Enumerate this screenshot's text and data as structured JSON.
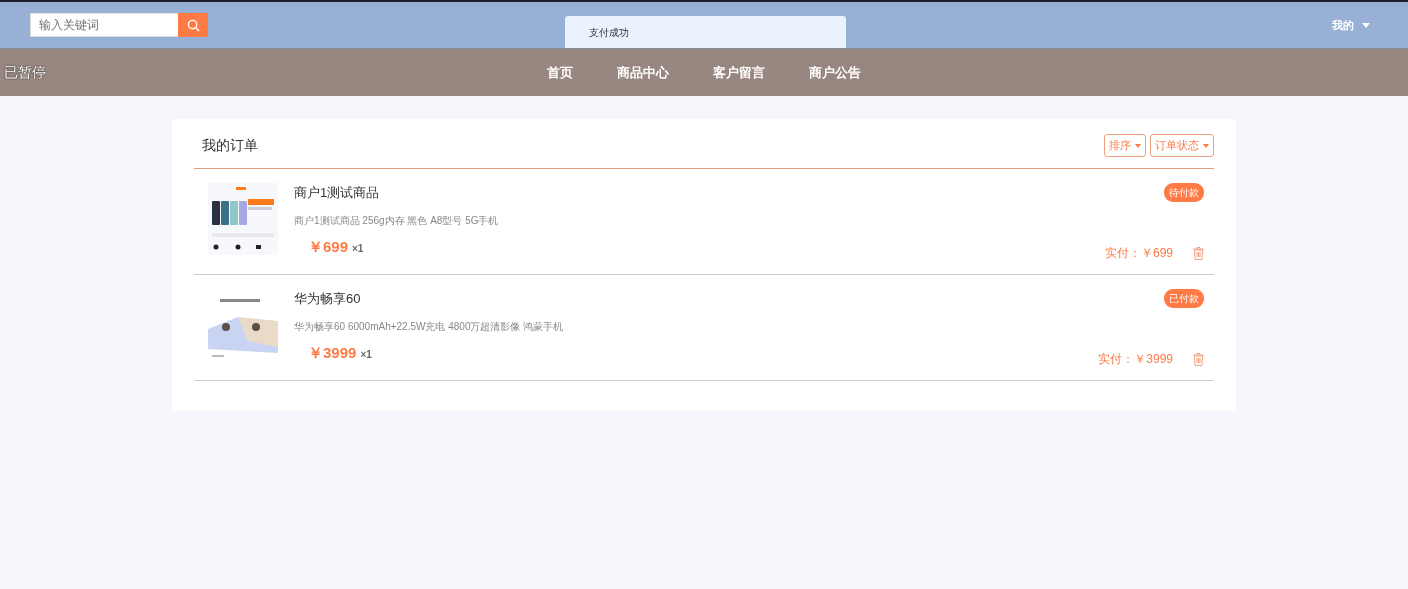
{
  "header": {
    "search": {
      "placeholder": "输入关键词"
    },
    "toast": "支付成功",
    "user_menu": "我的"
  },
  "navbar": {
    "status": "已暂停",
    "links": [
      "首页",
      "商品中心",
      "客户留言",
      "商户公告"
    ]
  },
  "orders": {
    "title": "我的订单",
    "filters": [
      "排序",
      "订单状态"
    ],
    "items": [
      {
        "name": "商户1测试商品",
        "description": "商户1测试商品 256g内存 黑色 A8型号 5G手机",
        "price": "￥699",
        "quantity": "×1",
        "status": "待付款",
        "paid": "实付：￥699"
      },
      {
        "name": "华为畅享60",
        "description": "华为畅享60 6000mAh+22.5W充电 4800万超清影像 鸿蒙手机",
        "price": "￥3999",
        "quantity": "×1",
        "status": "已付款",
        "paid": "实付：￥3999"
      }
    ]
  }
}
